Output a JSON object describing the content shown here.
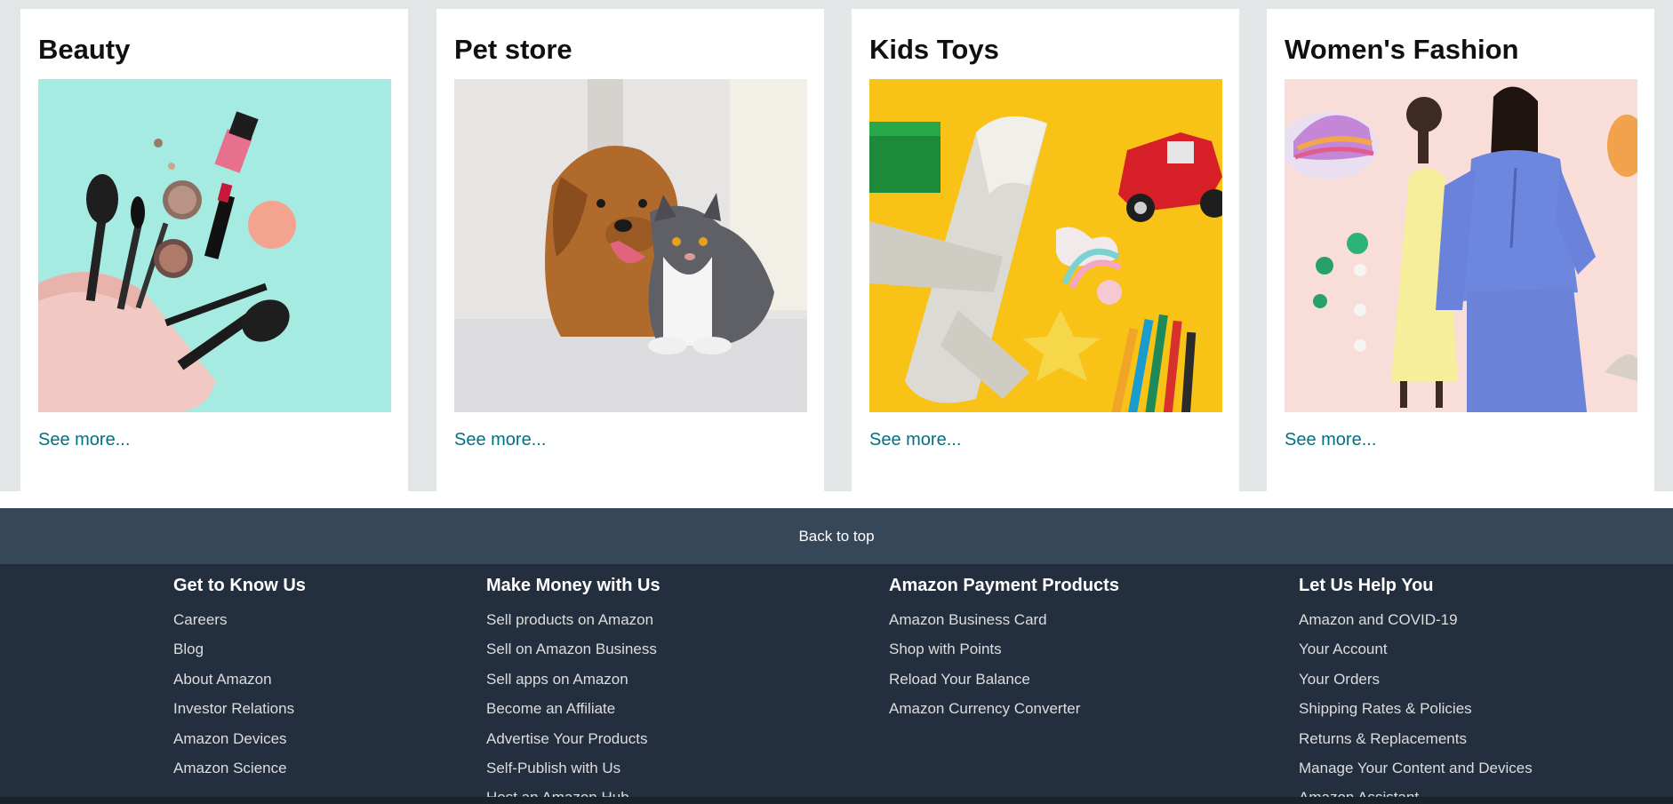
{
  "cards": [
    {
      "title": "Beauty",
      "link": "See more..."
    },
    {
      "title": "Pet store",
      "link": "See more..."
    },
    {
      "title": "Kids Toys",
      "link": "See more..."
    },
    {
      "title": "Women's Fashion",
      "link": "See more..."
    }
  ],
  "back_to_top": "Back to top",
  "footer": {
    "columns": [
      {
        "heading": "Get to Know Us",
        "links": [
          "Careers",
          "Blog",
          "About Amazon",
          "Investor Relations",
          "Amazon Devices",
          "Amazon Science"
        ]
      },
      {
        "heading": "Make Money with Us",
        "links": [
          "Sell products on Amazon",
          "Sell on Amazon Business",
          "Sell apps on Amazon",
          "Become an Affiliate",
          "Advertise Your Products",
          "Self-Publish with Us",
          "Host an Amazon Hub"
        ]
      },
      {
        "heading": "Amazon Payment Products",
        "links": [
          "Amazon Business Card",
          "Shop with Points",
          "Reload Your Balance",
          "Amazon Currency Converter"
        ]
      },
      {
        "heading": "Let Us Help You",
        "links": [
          "Amazon and COVID-19",
          "Your Account",
          "Your Orders",
          "Shipping Rates & Policies",
          "Returns & Replacements",
          "Manage Your Content and Devices",
          "Amazon Assistant"
        ]
      }
    ]
  },
  "colors": {
    "page_bg": "#e3e6e6",
    "link": "#007185",
    "back_to_top_bg": "#37475a",
    "footer_bg": "#232f3e"
  }
}
